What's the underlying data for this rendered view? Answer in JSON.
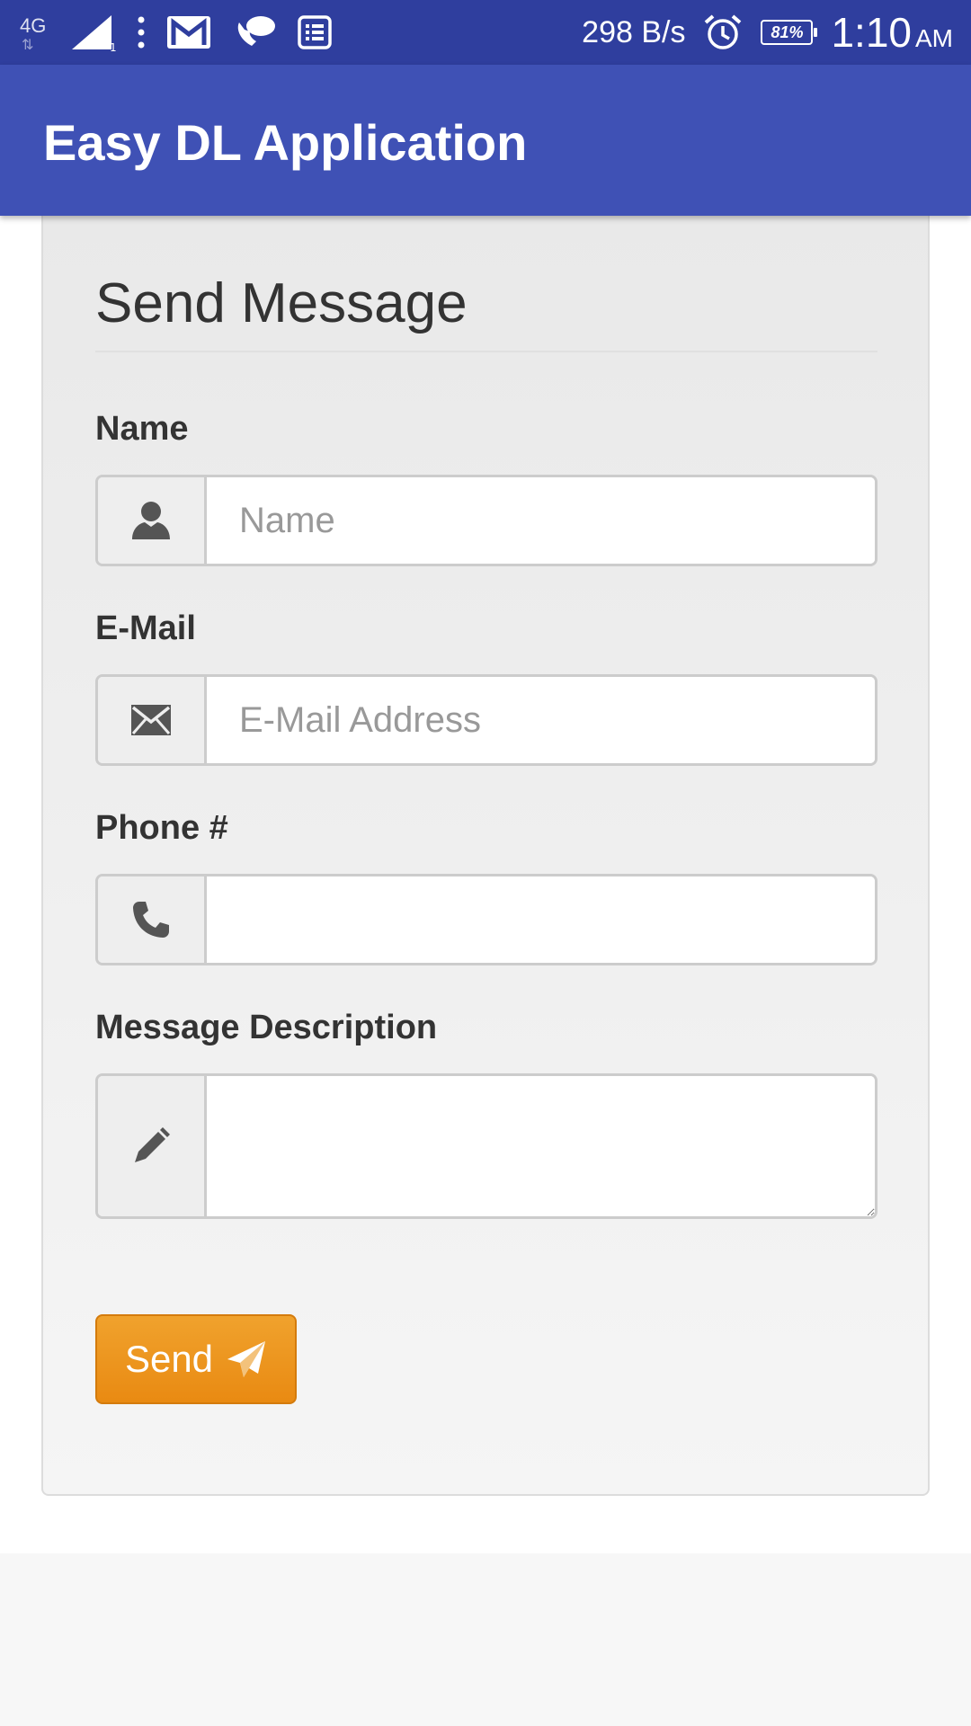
{
  "status_bar": {
    "network": "4G",
    "network_speed": "298 B/s",
    "battery": "81%",
    "time": "1:10",
    "ampm": "AM",
    "icons": [
      "signal-icon",
      "more-vert-icon",
      "gmail-icon",
      "chat-icon",
      "news-icon",
      "alarm-icon",
      "battery-icon"
    ]
  },
  "app_bar": {
    "title": "Easy DL Application"
  },
  "form": {
    "title": "Send Message",
    "name": {
      "label": "Name",
      "placeholder": "Name",
      "value": "",
      "icon": "user-icon"
    },
    "email": {
      "label": "E-Mail",
      "placeholder": "E-Mail Address",
      "value": "",
      "icon": "envelope-icon"
    },
    "phone": {
      "label": "Phone #",
      "placeholder": "",
      "value": "",
      "icon": "phone-icon"
    },
    "message": {
      "label": "Message Description",
      "placeholder": "",
      "value": "",
      "icon": "pencil-icon"
    },
    "send_button": {
      "label": "Send",
      "icon": "send-icon"
    }
  },
  "colors": {
    "status_bar": "#2f3e9e",
    "app_bar": "#3f51b5",
    "send_button": "#ee9a1f"
  }
}
